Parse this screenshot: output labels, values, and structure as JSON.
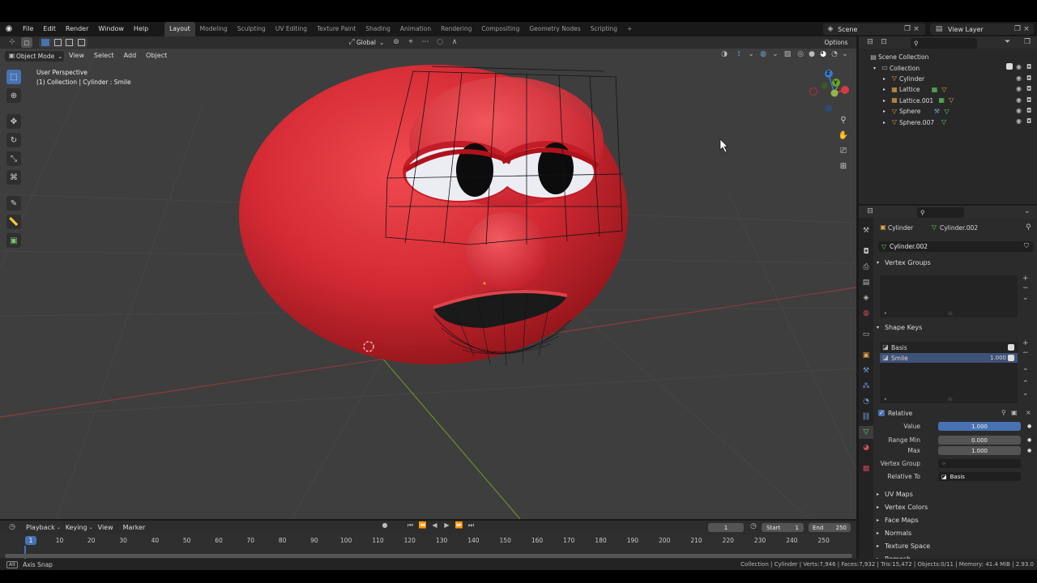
{
  "topbar": {
    "menus": [
      "File",
      "Edit",
      "Render",
      "Window",
      "Help"
    ],
    "workspaces": [
      "Layout",
      "Modeling",
      "Sculpting",
      "UV Editing",
      "Texture Paint",
      "Shading",
      "Animation",
      "Rendering",
      "Compositing",
      "Geometry Nodes",
      "Scripting"
    ],
    "active_workspace": "Layout",
    "add_tab": "+",
    "scene": "Scene",
    "view_layer": "View Layer"
  },
  "viewport_header": {
    "mode": "Object Mode",
    "menus": [
      "View",
      "Select",
      "Add",
      "Object"
    ],
    "transform_orientation": "Global",
    "options": "Options"
  },
  "viewport": {
    "perspective": "User Perspective",
    "collection_info": "(1) Collection | Cylinder : Smile",
    "gizmo": {
      "z": "Z",
      "y": "Y"
    }
  },
  "outliner": {
    "root": "Scene Collection",
    "collection": "Collection",
    "items": [
      "Cylinder",
      "Lattice",
      "Lattice.001",
      "Sphere",
      "Sphere.007"
    ]
  },
  "properties": {
    "object": "Cylinder",
    "mesh": "Cylinder.002",
    "mesh_field": "Cylinder.002",
    "vertex_groups": "Vertex Groups",
    "shape_keys": "Shape Keys",
    "keys": [
      {
        "name": "Basis",
        "value": ""
      },
      {
        "name": "Smile",
        "value": "1.000"
      }
    ],
    "relative_label": "Relative",
    "value_label": "Value",
    "value": "1.000",
    "value_fraction": 1.0,
    "range_min_label": "Range Min",
    "range_min": "0.000",
    "max_label": "Max",
    "max": "1.000",
    "vertex_group_label": "Vertex Group",
    "relative_to_label": "Relative To",
    "relative_to": "Basis",
    "collapsed_panels": [
      "UV Maps",
      "Vertex Colors",
      "Face Maps",
      "Normals",
      "Texture Space",
      "Remesh"
    ]
  },
  "timeline": {
    "menus": [
      "Playback",
      "Keying",
      "View",
      "Marker"
    ],
    "current_frame": "1",
    "start_label": "Start",
    "start": "1",
    "end_label": "End",
    "end": "250",
    "ticks": [
      "1",
      "10",
      "20",
      "30",
      "40",
      "50",
      "60",
      "70",
      "80",
      "90",
      "100",
      "110",
      "120",
      "130",
      "140",
      "150",
      "160",
      "170",
      "180",
      "190",
      "200",
      "210",
      "220",
      "230",
      "240",
      "250"
    ]
  },
  "statusbar": {
    "left": "Axis Snap",
    "right": "Collection | Cylinder | Verts:7,946 | Faces:7,932 | Tris:15,472 | Objects:0/11 | Memory: 41.4 MiB | 2.93.0"
  },
  "colors": {
    "accent": "#4772b3",
    "object_orange": "#e5a34a",
    "mesh_green": "#5fd06a",
    "tomato_red": "#d42a34"
  }
}
